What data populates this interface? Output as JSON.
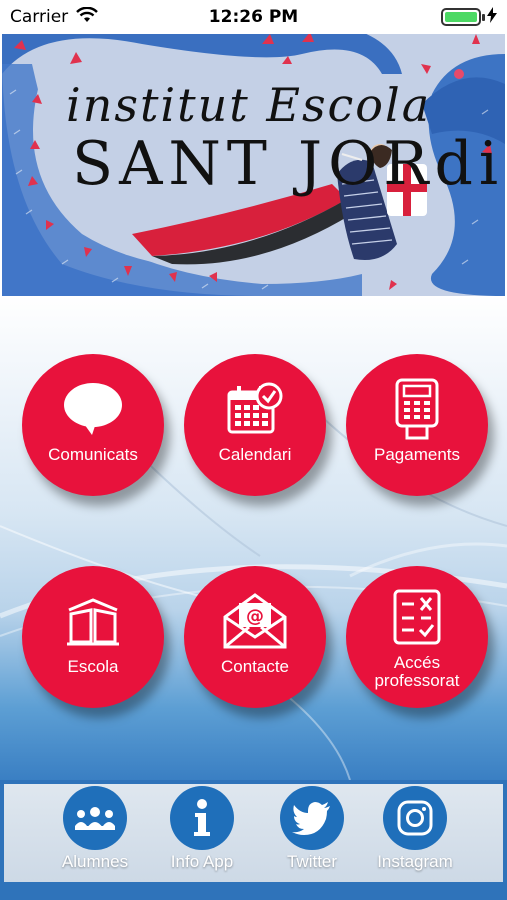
{
  "status_bar": {
    "carrier": "Carrier",
    "time": "12:26 PM",
    "battery_level": 1.0
  },
  "banner": {
    "title_line1": "institut Escola",
    "title_line2": "SANT JORdi"
  },
  "menu": [
    {
      "label": "Comunicats",
      "icon": "speech-bubble-icon"
    },
    {
      "label": "Calendari",
      "icon": "calendar-icon"
    },
    {
      "label": "Pagaments",
      "icon": "payment-terminal-icon"
    },
    {
      "label": "Escola",
      "icon": "book-icon"
    },
    {
      "label": "Contacte",
      "icon": "envelope-icon"
    },
    {
      "label": "Accés professorat",
      "icon": "checklist-icon"
    }
  ],
  "tab_bar": [
    {
      "label": "Alumnes",
      "icon": "students-icon"
    },
    {
      "label": "Info App",
      "icon": "info-icon"
    },
    {
      "label": "Twitter",
      "icon": "twitter-icon"
    },
    {
      "label": "Instagram",
      "icon": "instagram-icon"
    }
  ],
  "colors": {
    "tile_red": "#e8123c",
    "tab_blue": "#1f6fba",
    "battery_green": "#4cd964"
  }
}
